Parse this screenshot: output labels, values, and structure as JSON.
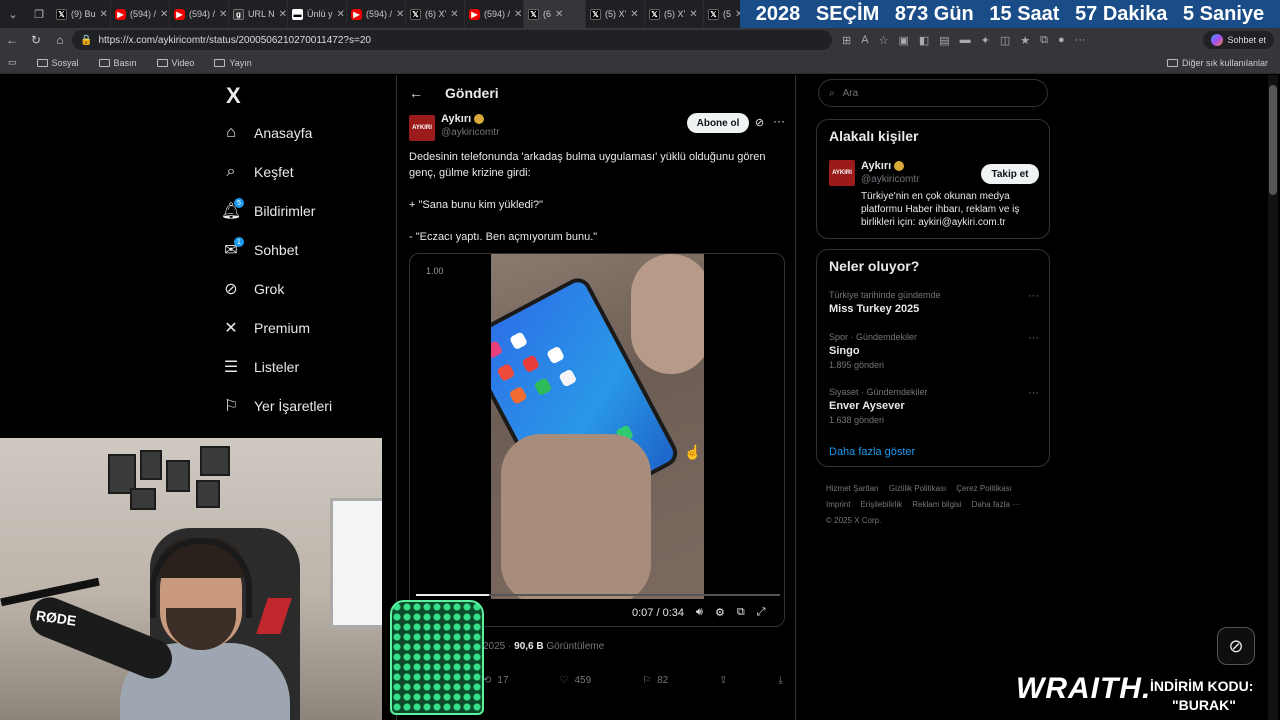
{
  "browser": {
    "tabs": [
      {
        "icon": "x",
        "label": "(9) Bu"
      },
      {
        "icon": "yt",
        "label": "(594) /"
      },
      {
        "icon": "yt",
        "label": "(594) /"
      },
      {
        "icon": "g",
        "label": "URL N"
      },
      {
        "icon": "u",
        "label": "Ünlü y"
      },
      {
        "icon": "yt",
        "label": "(594) /"
      },
      {
        "icon": "x",
        "label": "(6) X'"
      },
      {
        "icon": "yt",
        "label": "(594) /"
      },
      {
        "icon": "x",
        "label": "(6"
      },
      {
        "icon": "x",
        "label": "(5) X'"
      },
      {
        "icon": "x",
        "label": "(5) X'"
      },
      {
        "icon": "x",
        "label": "(5"
      }
    ],
    "url": "https://x.com/aykiricomtr/status/2000506210270011472?s=20",
    "sohbet_label": "Sohbet et",
    "bookmarks": [
      "Sosyal",
      "Basın",
      "Video",
      "Yayın"
    ],
    "other_bookmarks": "Diğer sık kullanılanlar"
  },
  "counter": {
    "year": "2028",
    "label": "SEÇİM",
    "days": "873 Gün",
    "hours": "15 Saat",
    "minutes": "57 Dakika",
    "seconds": "5 Saniye"
  },
  "nav": {
    "logo": "X",
    "items": [
      {
        "label": "Anasayfa"
      },
      {
        "label": "Keşfet"
      },
      {
        "label": "Bildirimler",
        "badge": "5"
      },
      {
        "label": "Sohbet",
        "badge": "1"
      },
      {
        "label": "Grok"
      },
      {
        "label": "Premium"
      },
      {
        "label": "Listeler"
      },
      {
        "label": "Yer İşaretleri"
      }
    ]
  },
  "post": {
    "header": "Gönderi",
    "author_name": "Aykırı",
    "author_handle": "@aykiricomtr",
    "avatar_text": "AYKIRI",
    "subscribe_label": "Abone ol",
    "text_1": "Dedesinin telefonunda 'arkadaş bulma uygulaması' yüklü olduğunu gören genç, gülme krizine girdi:",
    "text_2": "+ \"Sana bunu kim yükledi?\"",
    "text_3": "- \"Eczacı yaptı. Ben açmıyorum bunu.\"",
    "video": {
      "speed": "1.00",
      "time": "0:07 / 0:34",
      "progress": 0.2
    },
    "meta_date": "2025",
    "meta_views": "90,6 B",
    "meta_views_label": "Görüntüleme",
    "reposts": "17",
    "likes": "459",
    "bookmarks": "82"
  },
  "sidebar": {
    "search_placeholder": "Ara",
    "related_title": "Alakalı kişiler",
    "person": {
      "name": "Aykırı",
      "handle": "@aykiricomtr",
      "bio": "Türkiye'nin en çok okunan medya platformu Haber ihbarı, reklam ve iş birlikleri için: aykiri@aykiri.com.tr",
      "follow_label": "Takip et"
    },
    "trends_title": "Neler oluyor?",
    "trends": [
      {
        "category": "Türkiye tarihinde gündemde",
        "name": "Miss Turkey 2025",
        "count": ""
      },
      {
        "category": "Spor · Gündemdekiler",
        "name": "Singo",
        "count": "1.895 gönderi"
      },
      {
        "category": "Siyaset · Gündemdekiler",
        "name": "Enver Aysever",
        "count": "1.638 gönderi"
      }
    ],
    "show_more": "Daha fazla göster",
    "footer": [
      "Hizmet Şartları",
      "Gizlilik Politikası",
      "Çerez Politikası",
      "Imprint",
      "Erişilebilirlik",
      "Reklam bilgisi",
      "Daha fazla ···",
      "© 2025 X Corp."
    ]
  },
  "overlay": {
    "mic_brand": "RØDE",
    "sponsor": "WRAITH.",
    "promo_line1": "İNDİRİM KODU:",
    "promo_line2": "\"BURAK\""
  }
}
